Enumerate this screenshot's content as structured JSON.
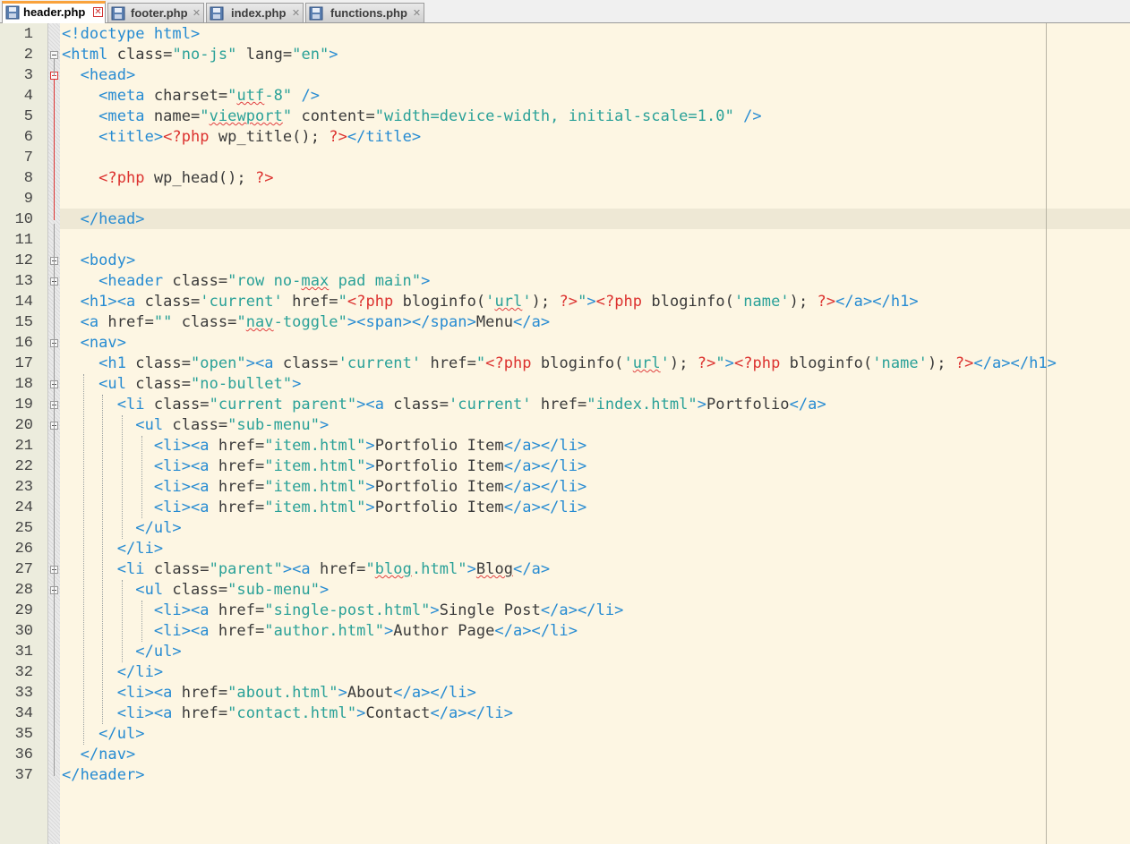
{
  "tabs": [
    {
      "label": "header.php",
      "active": true
    },
    {
      "label": "footer.php",
      "active": false
    },
    {
      "label": "index.php",
      "active": false
    },
    {
      "label": "functions.php",
      "active": false
    }
  ],
  "icons": {
    "tab_icon": "floppy-disk-icon",
    "close_icon": "close-icon",
    "fold_icon": "fold-minus-icon"
  },
  "colors": {
    "background": "#fdf6e3",
    "tag": "#268bd2",
    "string": "#2aa198",
    "php": "#dc322f",
    "plain": "#3a3a3a",
    "tab_accent": "#f9a23c"
  },
  "line_numbers": [
    "1",
    "2",
    "3",
    "4",
    "5",
    "6",
    "7",
    "8",
    "9",
    "10",
    "11",
    "12",
    "13",
    "14",
    "15",
    "16",
    "17",
    "18",
    "19",
    "20",
    "21",
    "22",
    "23",
    "24",
    "25",
    "26",
    "27",
    "28",
    "29",
    "30",
    "31",
    "32",
    "33",
    "34",
    "35",
    "36",
    "37"
  ],
  "current_line": "10",
  "code": [
    [
      [
        "t",
        "<!doctype html>"
      ]
    ],
    [
      [
        "t",
        "<html"
      ],
      [
        "a",
        " class="
      ],
      [
        "s",
        "\"no-js\""
      ],
      [
        "a",
        " lang="
      ],
      [
        "s",
        "\"en\""
      ],
      [
        "t",
        ">"
      ]
    ],
    [
      [
        "t",
        "  <head>"
      ]
    ],
    [
      [
        "t",
        "    <meta"
      ],
      [
        "a",
        " charset="
      ],
      [
        "s",
        "\""
      ],
      [
        "sq",
        "utf"
      ],
      [
        "s",
        "-8\""
      ],
      [
        "t",
        " />"
      ]
    ],
    [
      [
        "t",
        "    <meta"
      ],
      [
        "a",
        " name="
      ],
      [
        "s",
        "\""
      ],
      [
        "sq",
        "viewport"
      ],
      [
        "s",
        "\""
      ],
      [
        "a",
        " content="
      ],
      [
        "s",
        "\"width=device-width, initial-scale=1.0\""
      ],
      [
        "t",
        " />"
      ]
    ],
    [
      [
        "t",
        "    <title>"
      ],
      [
        "p",
        "<?php"
      ],
      [
        "x",
        " wp_title(); "
      ],
      [
        "p",
        "?>"
      ],
      [
        "t",
        "</title>"
      ]
    ],
    [],
    [
      [
        "p",
        "    <?php"
      ],
      [
        "x",
        " wp_head(); "
      ],
      [
        "p",
        "?>"
      ]
    ],
    [],
    [
      [
        "t",
        "  </head>"
      ]
    ],
    [],
    [
      [
        "t",
        "  <body>"
      ]
    ],
    [
      [
        "t",
        "    <header"
      ],
      [
        "a",
        " class="
      ],
      [
        "s",
        "\"row no-"
      ],
      [
        "sq",
        "max"
      ],
      [
        "s",
        " pad main\""
      ],
      [
        "t",
        ">"
      ]
    ],
    [
      [
        "t",
        "  <h1><a"
      ],
      [
        "a",
        " class="
      ],
      [
        "s",
        "'current'"
      ],
      [
        "a",
        " href="
      ],
      [
        "s",
        "\""
      ],
      [
        "p",
        "<?php"
      ],
      [
        "x",
        " bloginfo("
      ],
      [
        "s",
        "'"
      ],
      [
        "sq",
        "url"
      ],
      [
        "s",
        "'"
      ],
      [
        "x",
        "); "
      ],
      [
        "p",
        "?>"
      ],
      [
        "s",
        "\""
      ],
      [
        "t",
        ">"
      ],
      [
        "p",
        "<?php"
      ],
      [
        "x",
        " bloginfo("
      ],
      [
        "s",
        "'name'"
      ],
      [
        "x",
        "); "
      ],
      [
        "p",
        "?>"
      ],
      [
        "t",
        "</a></h1>"
      ]
    ],
    [
      [
        "t",
        "  <a"
      ],
      [
        "a",
        " href="
      ],
      [
        "s",
        "\"\""
      ],
      [
        "a",
        " class="
      ],
      [
        "s",
        "\""
      ],
      [
        "sq",
        "nav"
      ],
      [
        "s",
        "-toggle\""
      ],
      [
        "t",
        "><span></span>"
      ],
      [
        "x",
        "Menu"
      ],
      [
        "t",
        "</a>"
      ]
    ],
    [
      [
        "t",
        "  <nav>"
      ]
    ],
    [
      [
        "t",
        "    <h1"
      ],
      [
        "a",
        " class="
      ],
      [
        "s",
        "\"open\""
      ],
      [
        "t",
        "><a"
      ],
      [
        "a",
        " class="
      ],
      [
        "s",
        "'current'"
      ],
      [
        "a",
        " href="
      ],
      [
        "s",
        "\""
      ],
      [
        "p",
        "<?php"
      ],
      [
        "x",
        " bloginfo("
      ],
      [
        "s",
        "'"
      ],
      [
        "sq",
        "url"
      ],
      [
        "s",
        "'"
      ],
      [
        "x",
        "); "
      ],
      [
        "p",
        "?>"
      ],
      [
        "s",
        "\""
      ],
      [
        "t",
        ">"
      ],
      [
        "p",
        "<?php"
      ],
      [
        "x",
        " bloginfo("
      ],
      [
        "s",
        "'name'"
      ],
      [
        "x",
        "); "
      ],
      [
        "p",
        "?>"
      ],
      [
        "t",
        "</a></h1>"
      ]
    ],
    [
      [
        "t",
        "    <ul"
      ],
      [
        "a",
        " class="
      ],
      [
        "s",
        "\"no-bullet\""
      ],
      [
        "t",
        ">"
      ]
    ],
    [
      [
        "t",
        "      <li"
      ],
      [
        "a",
        " class="
      ],
      [
        "s",
        "\"current parent\""
      ],
      [
        "t",
        "><a"
      ],
      [
        "a",
        " class="
      ],
      [
        "s",
        "'current'"
      ],
      [
        "a",
        " href="
      ],
      [
        "s",
        "\"index.html\""
      ],
      [
        "t",
        ">"
      ],
      [
        "x",
        "Portfolio"
      ],
      [
        "t",
        "</a>"
      ]
    ],
    [
      [
        "t",
        "        <ul"
      ],
      [
        "a",
        " class="
      ],
      [
        "s",
        "\"sub-menu\""
      ],
      [
        "t",
        ">"
      ]
    ],
    [
      [
        "t",
        "          <li><a"
      ],
      [
        "a",
        " href="
      ],
      [
        "s",
        "\"item.html\""
      ],
      [
        "t",
        ">"
      ],
      [
        "x",
        "Portfolio Item"
      ],
      [
        "t",
        "</a></li>"
      ]
    ],
    [
      [
        "t",
        "          <li><a"
      ],
      [
        "a",
        " href="
      ],
      [
        "s",
        "\"item.html\""
      ],
      [
        "t",
        ">"
      ],
      [
        "x",
        "Portfolio Item"
      ],
      [
        "t",
        "</a></li>"
      ]
    ],
    [
      [
        "t",
        "          <li><a"
      ],
      [
        "a",
        " href="
      ],
      [
        "s",
        "\"item.html\""
      ],
      [
        "t",
        ">"
      ],
      [
        "x",
        "Portfolio Item"
      ],
      [
        "t",
        "</a></li>"
      ]
    ],
    [
      [
        "t",
        "          <li><a"
      ],
      [
        "a",
        " href="
      ],
      [
        "s",
        "\"item.html\""
      ],
      [
        "t",
        ">"
      ],
      [
        "x",
        "Portfolio Item"
      ],
      [
        "t",
        "</a></li>"
      ]
    ],
    [
      [
        "t",
        "        </ul>"
      ]
    ],
    [
      [
        "t",
        "      </li>"
      ]
    ],
    [
      [
        "t",
        "      <li"
      ],
      [
        "a",
        " class="
      ],
      [
        "s",
        "\"parent\""
      ],
      [
        "t",
        "><a"
      ],
      [
        "a",
        " href="
      ],
      [
        "s",
        "\""
      ],
      [
        "sq",
        "blog"
      ],
      [
        "s",
        ".html\""
      ],
      [
        "t",
        ">"
      ],
      [
        "sq",
        "Blog"
      ],
      [
        "t",
        "</a>"
      ]
    ],
    [
      [
        "t",
        "        <ul"
      ],
      [
        "a",
        " class="
      ],
      [
        "s",
        "\"sub-menu\""
      ],
      [
        "t",
        ">"
      ]
    ],
    [
      [
        "t",
        "          <li><a"
      ],
      [
        "a",
        " href="
      ],
      [
        "s",
        "\"single-post.html\""
      ],
      [
        "t",
        ">"
      ],
      [
        "x",
        "Single Post"
      ],
      [
        "t",
        "</a></li>"
      ]
    ],
    [
      [
        "t",
        "          <li><a"
      ],
      [
        "a",
        " href="
      ],
      [
        "s",
        "\"author.html\""
      ],
      [
        "t",
        ">"
      ],
      [
        "x",
        "Author Page"
      ],
      [
        "t",
        "</a></li>"
      ]
    ],
    [
      [
        "t",
        "        </ul>"
      ]
    ],
    [
      [
        "t",
        "      </li>"
      ]
    ],
    [
      [
        "t",
        "      <li><a"
      ],
      [
        "a",
        " href="
      ],
      [
        "s",
        "\"about.html\""
      ],
      [
        "t",
        ">"
      ],
      [
        "x",
        "About"
      ],
      [
        "t",
        "</a></li>"
      ]
    ],
    [
      [
        "t",
        "      <li><a"
      ],
      [
        "a",
        " href="
      ],
      [
        "s",
        "\"contact.html\""
      ],
      [
        "t",
        ">"
      ],
      [
        "x",
        "Contact"
      ],
      [
        "t",
        "</a></li>"
      ]
    ],
    [
      [
        "t",
        "    </ul>"
      ]
    ],
    [
      [
        "t",
        "  </nav>"
      ]
    ],
    [
      [
        "t",
        "</header>"
      ]
    ]
  ]
}
